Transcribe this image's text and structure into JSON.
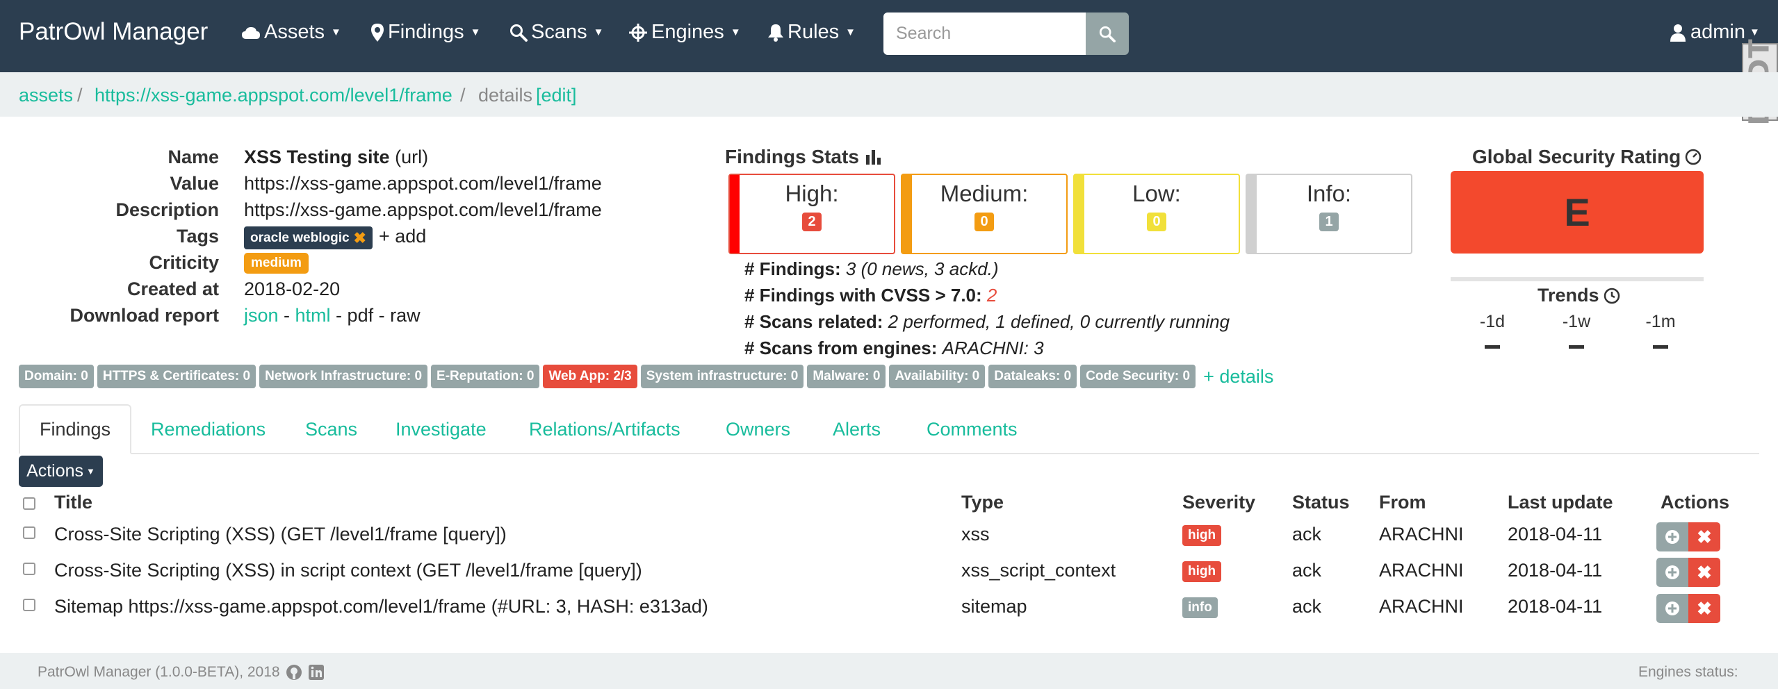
{
  "navbar": {
    "brand": "PatrOwl Manager",
    "menus": [
      {
        "label": "Assets",
        "icon": "cloud-icon"
      },
      {
        "label": "Findings",
        "icon": "map-marker-icon"
      },
      {
        "label": "Scans",
        "icon": "search-icon"
      },
      {
        "label": "Engines",
        "icon": "crosshairs-icon"
      },
      {
        "label": "Rules",
        "icon": "bell-icon"
      }
    ],
    "search_placeholder": "Search",
    "user": "admin"
  },
  "breadcrumb": {
    "root": "assets",
    "asset": "https://xss-game.appspot.com/level1/frame",
    "current": "details",
    "edit": "[edit]"
  },
  "asset": {
    "labels": {
      "name": "Name",
      "value": "Value",
      "description": "Description",
      "tags": "Tags",
      "criticity": "Criticity",
      "created": "Created at",
      "download": "Download report"
    },
    "name": "XSS Testing site",
    "name_type": "(url)",
    "value": "https://xss-game.appspot.com/level1/frame",
    "description": "https://xss-game.appspot.com/level1/frame",
    "tag": "oracle weblogic",
    "add_tag": "+ add",
    "criticity": "medium",
    "created_at": "2018-02-20",
    "report": {
      "json": "json",
      "html": "html",
      "pdf": "pdf",
      "raw": "raw",
      "sep": " - "
    }
  },
  "findings_stats": {
    "title": "Findings Stats",
    "boxes": [
      {
        "label": "High:",
        "count": "2",
        "color": "#e74c3c"
      },
      {
        "label": "Medium:",
        "count": "0",
        "color": "#f39c12"
      },
      {
        "label": "Low:",
        "count": "0",
        "color": "#f1e03a"
      },
      {
        "label": "Info:",
        "count": "1",
        "color": "#95a5a6"
      }
    ],
    "lines": {
      "findings_label": "# Findings",
      "findings_value": "3 (0 news, 3 ackd.)",
      "cvss_label": "# Findings with CVSS > 7.0",
      "cvss_value": "2",
      "scans_label": "# Scans related",
      "scans_value": "2 performed, 1 defined, 0 currently running",
      "engines_label": "# Scans from engines",
      "engines_value": "ARACHNI: 3",
      "colon": ": "
    }
  },
  "rating": {
    "title": "Global Security Rating",
    "grade": "E",
    "grade_color": "#f3492d",
    "trends_title": "Trends",
    "trends": [
      {
        "label": "-1d"
      },
      {
        "label": "-1w"
      },
      {
        "label": "-1m"
      }
    ]
  },
  "categories": [
    {
      "label": "Domain: 0",
      "danger": false
    },
    {
      "label": "HTTPS & Certificates: 0",
      "danger": false
    },
    {
      "label": "Network Infrastructure: 0",
      "danger": false
    },
    {
      "label": "E-Reputation: 0",
      "danger": false
    },
    {
      "label": "Web App: 2/3",
      "danger": true
    },
    {
      "label": "System infrastructure: 0",
      "danger": false
    },
    {
      "label": "Malware: 0",
      "danger": false
    },
    {
      "label": "Availability: 0",
      "danger": false
    },
    {
      "label": "Dataleaks: 0",
      "danger": false
    },
    {
      "label": "Code Security: 0",
      "danger": false
    }
  ],
  "categories_details": "+ details",
  "tabs": [
    "Findings",
    "Remediations",
    "Scans",
    "Investigate",
    "Relations/Artifacts",
    "Owners",
    "Alerts",
    "Comments"
  ],
  "actions_label": "Actions",
  "table": {
    "headers": {
      "title": "Title",
      "type": "Type",
      "severity": "Severity",
      "status": "Status",
      "from": "From",
      "updated": "Last update",
      "actions": "Actions"
    },
    "rows": [
      {
        "title": "Cross-Site Scripting (XSS) (GET /level1/frame [query])",
        "type": "xss",
        "severity": "high",
        "status": "ack",
        "from": "ARACHNI",
        "updated": "2018-04-11"
      },
      {
        "title": "Cross-Site Scripting (XSS) in script context (GET /level1/frame [query])",
        "type": "xss_script_context",
        "severity": "high",
        "status": "ack",
        "from": "ARACHNI",
        "updated": "2018-04-11"
      },
      {
        "title": "Sitemap https://xss-game.appspot.com/level1/frame (#URL: 3, HASH: e313ad)",
        "type": "sitemap",
        "severity": "info",
        "status": "ack",
        "from": "ARACHNI",
        "updated": "2018-04-11"
      }
    ]
  },
  "footer": {
    "text": "PatrOwl Manager (1.0.0-BETA), 2018",
    "engines": "Engines status:"
  },
  "side_logo": "DoDT"
}
